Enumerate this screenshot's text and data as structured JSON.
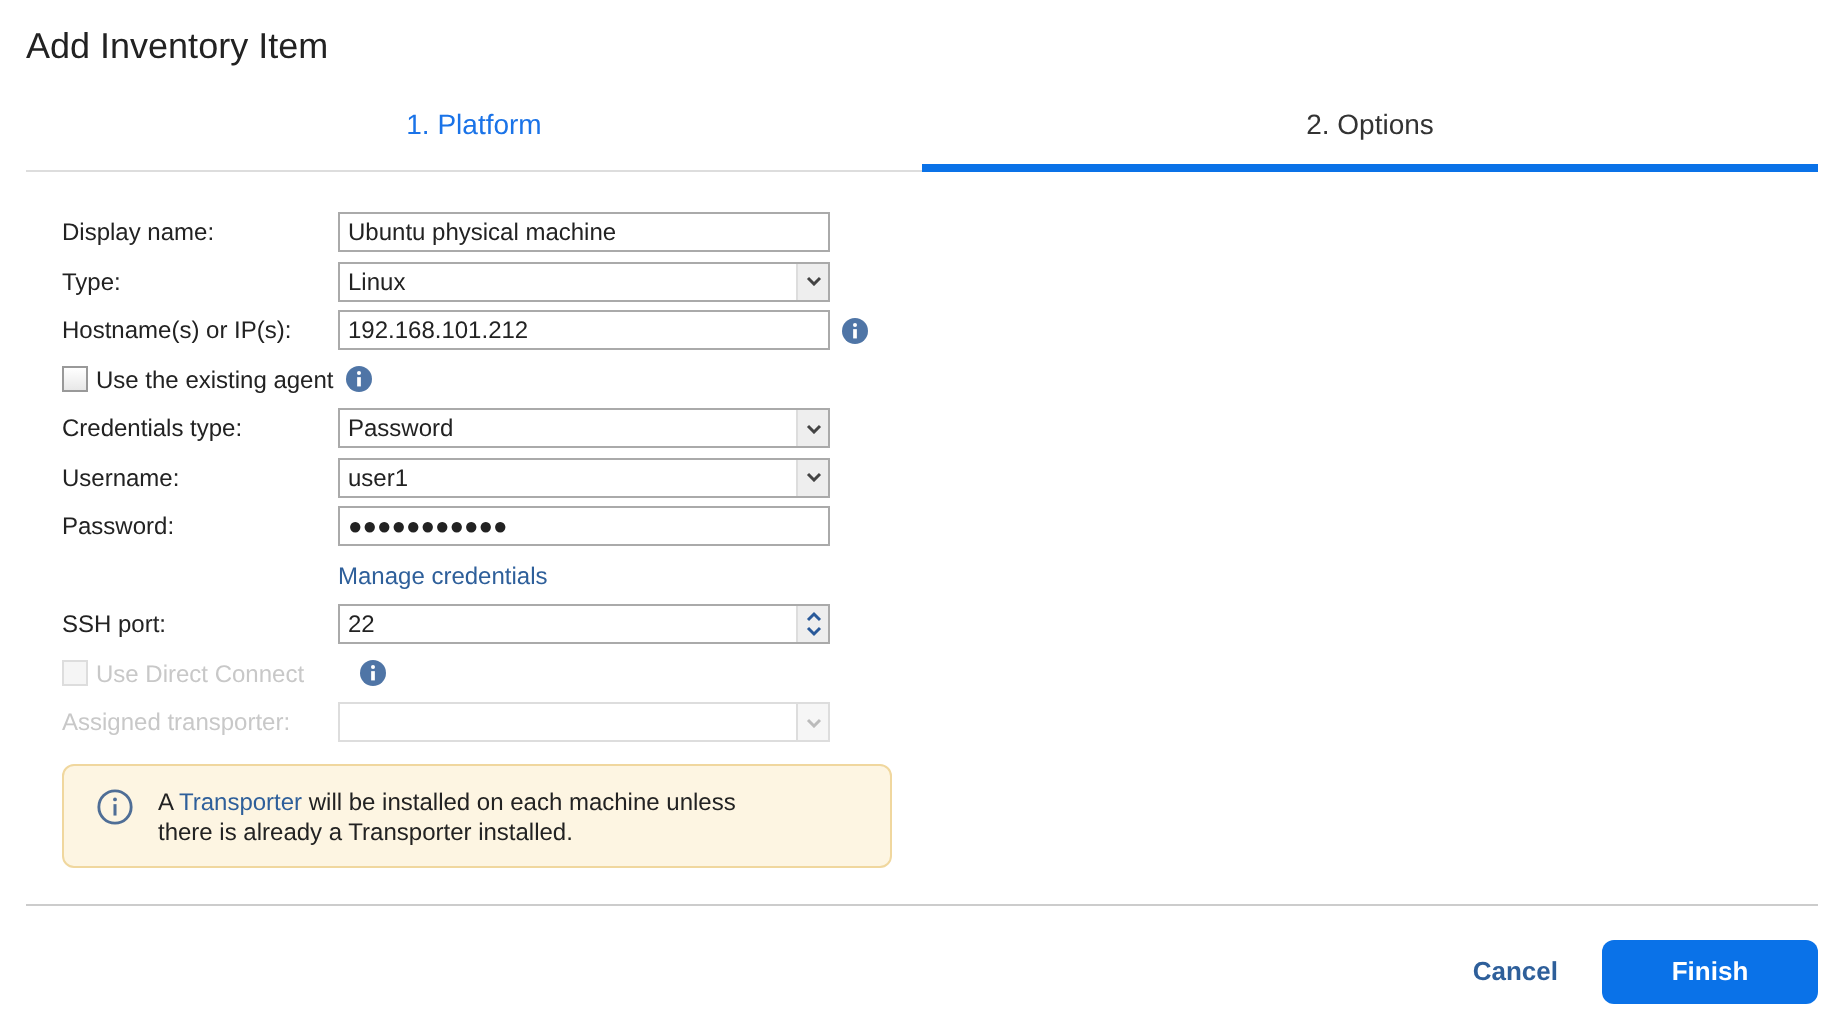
{
  "window": {
    "title": "Add Inventory Item"
  },
  "tabs": [
    {
      "label": "1. Platform",
      "selected": false
    },
    {
      "label": "2. Options",
      "selected": true
    }
  ],
  "form": [
    {
      "kind": "text",
      "label": "Display name:",
      "value": "Ubuntu physical machine",
      "disabled": false
    },
    {
      "kind": "select",
      "label": "Type:",
      "value": "Linux",
      "disabled": false
    },
    {
      "kind": "text",
      "label": "Hostname(s) or IP(s):",
      "value": "192.168.101.212",
      "disabled": false,
      "info": true
    },
    {
      "kind": "checkbox",
      "label": "Use the existing agent",
      "checked": false,
      "disabled": false,
      "info": true
    },
    {
      "kind": "select",
      "label": "Credentials type:",
      "value": "Password",
      "disabled": false
    },
    {
      "kind": "select",
      "label": "Username:",
      "value": "user1",
      "disabled": false
    },
    {
      "kind": "text",
      "label": "Password:",
      "value": "●●●●●●●●●●●",
      "disabled": false
    },
    {
      "kind": "link",
      "label": "Manage credentials"
    },
    {
      "kind": "spinner",
      "label": "SSH port:",
      "value": "22",
      "disabled": false
    },
    {
      "kind": "checkbox",
      "label": "Use Direct Connect",
      "checked": false,
      "disabled": true,
      "info": true
    },
    {
      "kind": "select",
      "label": "Assigned transporter:",
      "disabled": true
    }
  ],
  "notice": {
    "before": "A ",
    "link": "Transporter",
    "after": " will be installed on each machine unless there is already a Transporter installed."
  },
  "buttons": {
    "cancel": "Cancel",
    "finish": "Finish"
  }
}
